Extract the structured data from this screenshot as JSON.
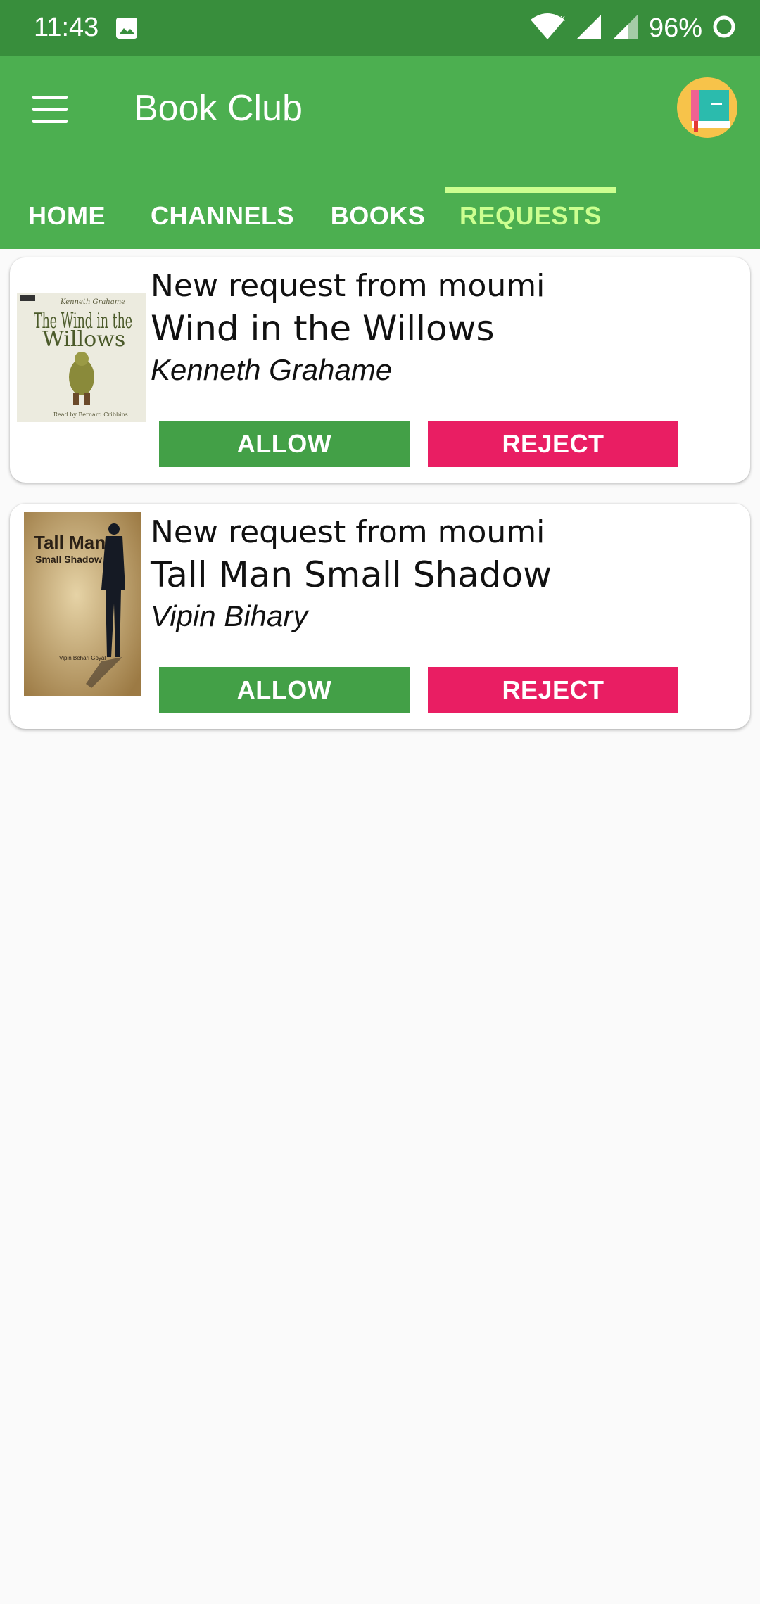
{
  "status_bar": {
    "time": "11:43",
    "battery": "96%",
    "icons": [
      "image-icon",
      "wifi-icon",
      "signal-icon",
      "signal-icon-2",
      "battery-ring-icon"
    ]
  },
  "app_bar": {
    "title": "Book Club",
    "menu_icon": "hamburger-menu-icon",
    "avatar_icon": "book-avatar-icon"
  },
  "tabs": [
    {
      "label": "HOME",
      "active": false
    },
    {
      "label": "CHANNELS",
      "active": false
    },
    {
      "label": "BOOKS",
      "active": false
    },
    {
      "label": "REQUESTS",
      "active": true
    }
  ],
  "requests": [
    {
      "request_text": "New request from moumi",
      "title": "Wind in the Willows",
      "author": "Kenneth Grahame",
      "cover": {
        "top": "Kenneth Grahame",
        "title_line1": "The Wind in the",
        "title_line2": "Willows",
        "bottom": "Read by Bernard Cribbins",
        "badge": "BBC"
      },
      "allow_label": "ALLOW",
      "reject_label": "REJECT"
    },
    {
      "request_text": "New request from moumi",
      "title": "Tall Man Small Shadow",
      "author": "Vipin Bihary",
      "cover": {
        "title_line1": "Tall Man",
        "title_line2": "Small Shadow",
        "bottom": "Vipin Behari Goyal"
      },
      "allow_label": "ALLOW",
      "reject_label": "REJECT"
    }
  ],
  "colors": {
    "status_bar": "#388e3c",
    "app_bar": "#4caf50",
    "active_tab": "#ccff90",
    "allow": "#43a047",
    "reject": "#e91e63"
  }
}
